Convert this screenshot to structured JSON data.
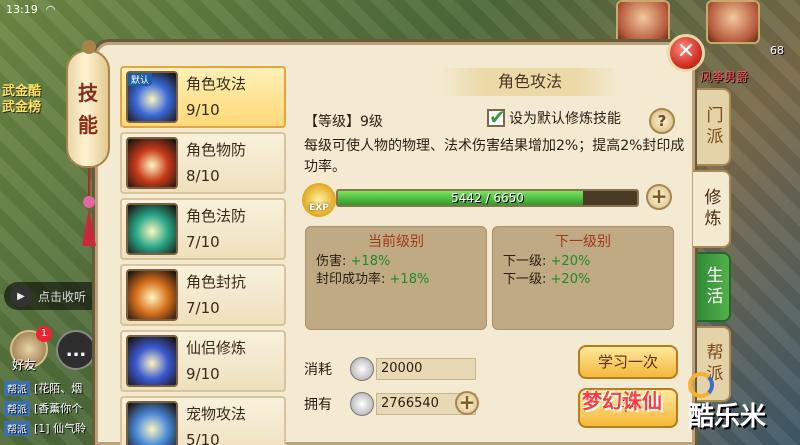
{
  "status": {
    "time": "13:19"
  },
  "background": {
    "left_texts": [
      "武金酷",
      "武金榜"
    ],
    "voice_label": "点击收听",
    "friend_label": "好友",
    "friend_badge": "1",
    "chat_button": "...",
    "chat_lines": [
      {
        "tag": "帮派",
        "text": "[花陌、烟"
      },
      {
        "tag": "帮派",
        "text": "[香薰你个"
      },
      {
        "tag": "帮派",
        "text": "[1] 仙气聆"
      }
    ],
    "portrait_levels": [
      "",
      "68"
    ],
    "portrait_name": "风筝男爵"
  },
  "panel": {
    "scroll_title": [
      "技",
      "能"
    ],
    "close_label": "✕",
    "detail_title": "角色攻法",
    "level_text": "【等级】9级",
    "default_checkbox_label": "设为默认修炼技能",
    "help_label": "?",
    "description": "每级可使人物的物理、法术伤害结果增加2%；提高2%封印成功率。",
    "exp": {
      "label": "EXP",
      "current": 5442,
      "max": 6650,
      "text": "5442 / 6650"
    },
    "exp_plus": "+",
    "current_level": {
      "title": "当前级别",
      "rows": [
        {
          "label": "伤害:",
          "value": "+18%"
        },
        {
          "label": "封印成功率:",
          "value": "+18%"
        }
      ]
    },
    "next_level": {
      "title": "下一级别",
      "rows": [
        {
          "label": "下一级:",
          "value": "+20%"
        },
        {
          "label": "下一级:",
          "value": "+20%"
        }
      ]
    },
    "cost_label": "消耗",
    "cost_value": "20000",
    "own_label": "拥有",
    "own_value": "2766540",
    "own_plus": "+",
    "learn_once": "学习一次",
    "learn_second": "学"
  },
  "skills": [
    {
      "name": "角色攻法",
      "level": "9/10",
      "selected": true,
      "default_tag": "默认",
      "color": "#3a6ad8"
    },
    {
      "name": "角色物防",
      "level": "8/10",
      "selected": false,
      "color": "#c83a1a"
    },
    {
      "name": "角色法防",
      "level": "7/10",
      "selected": false,
      "color": "#2aa88a"
    },
    {
      "name": "角色封抗",
      "level": "7/10",
      "selected": false,
      "color": "#d8701a"
    },
    {
      "name": "仙侣修炼",
      "level": "9/10",
      "selected": false,
      "color": "#3a5ad0"
    },
    {
      "name": "宠物攻法",
      "level": "5/10",
      "selected": false,
      "color": "#4a8ad8"
    }
  ],
  "side_tabs": [
    {
      "label": "门派",
      "active": false,
      "green": false
    },
    {
      "label": "修炼",
      "active": true,
      "green": false
    },
    {
      "label": "生活",
      "active": false,
      "green": true
    },
    {
      "label": "帮派",
      "active": false,
      "green": false
    }
  ],
  "brand": "梦幻诛仙",
  "watermark": "酷乐米"
}
